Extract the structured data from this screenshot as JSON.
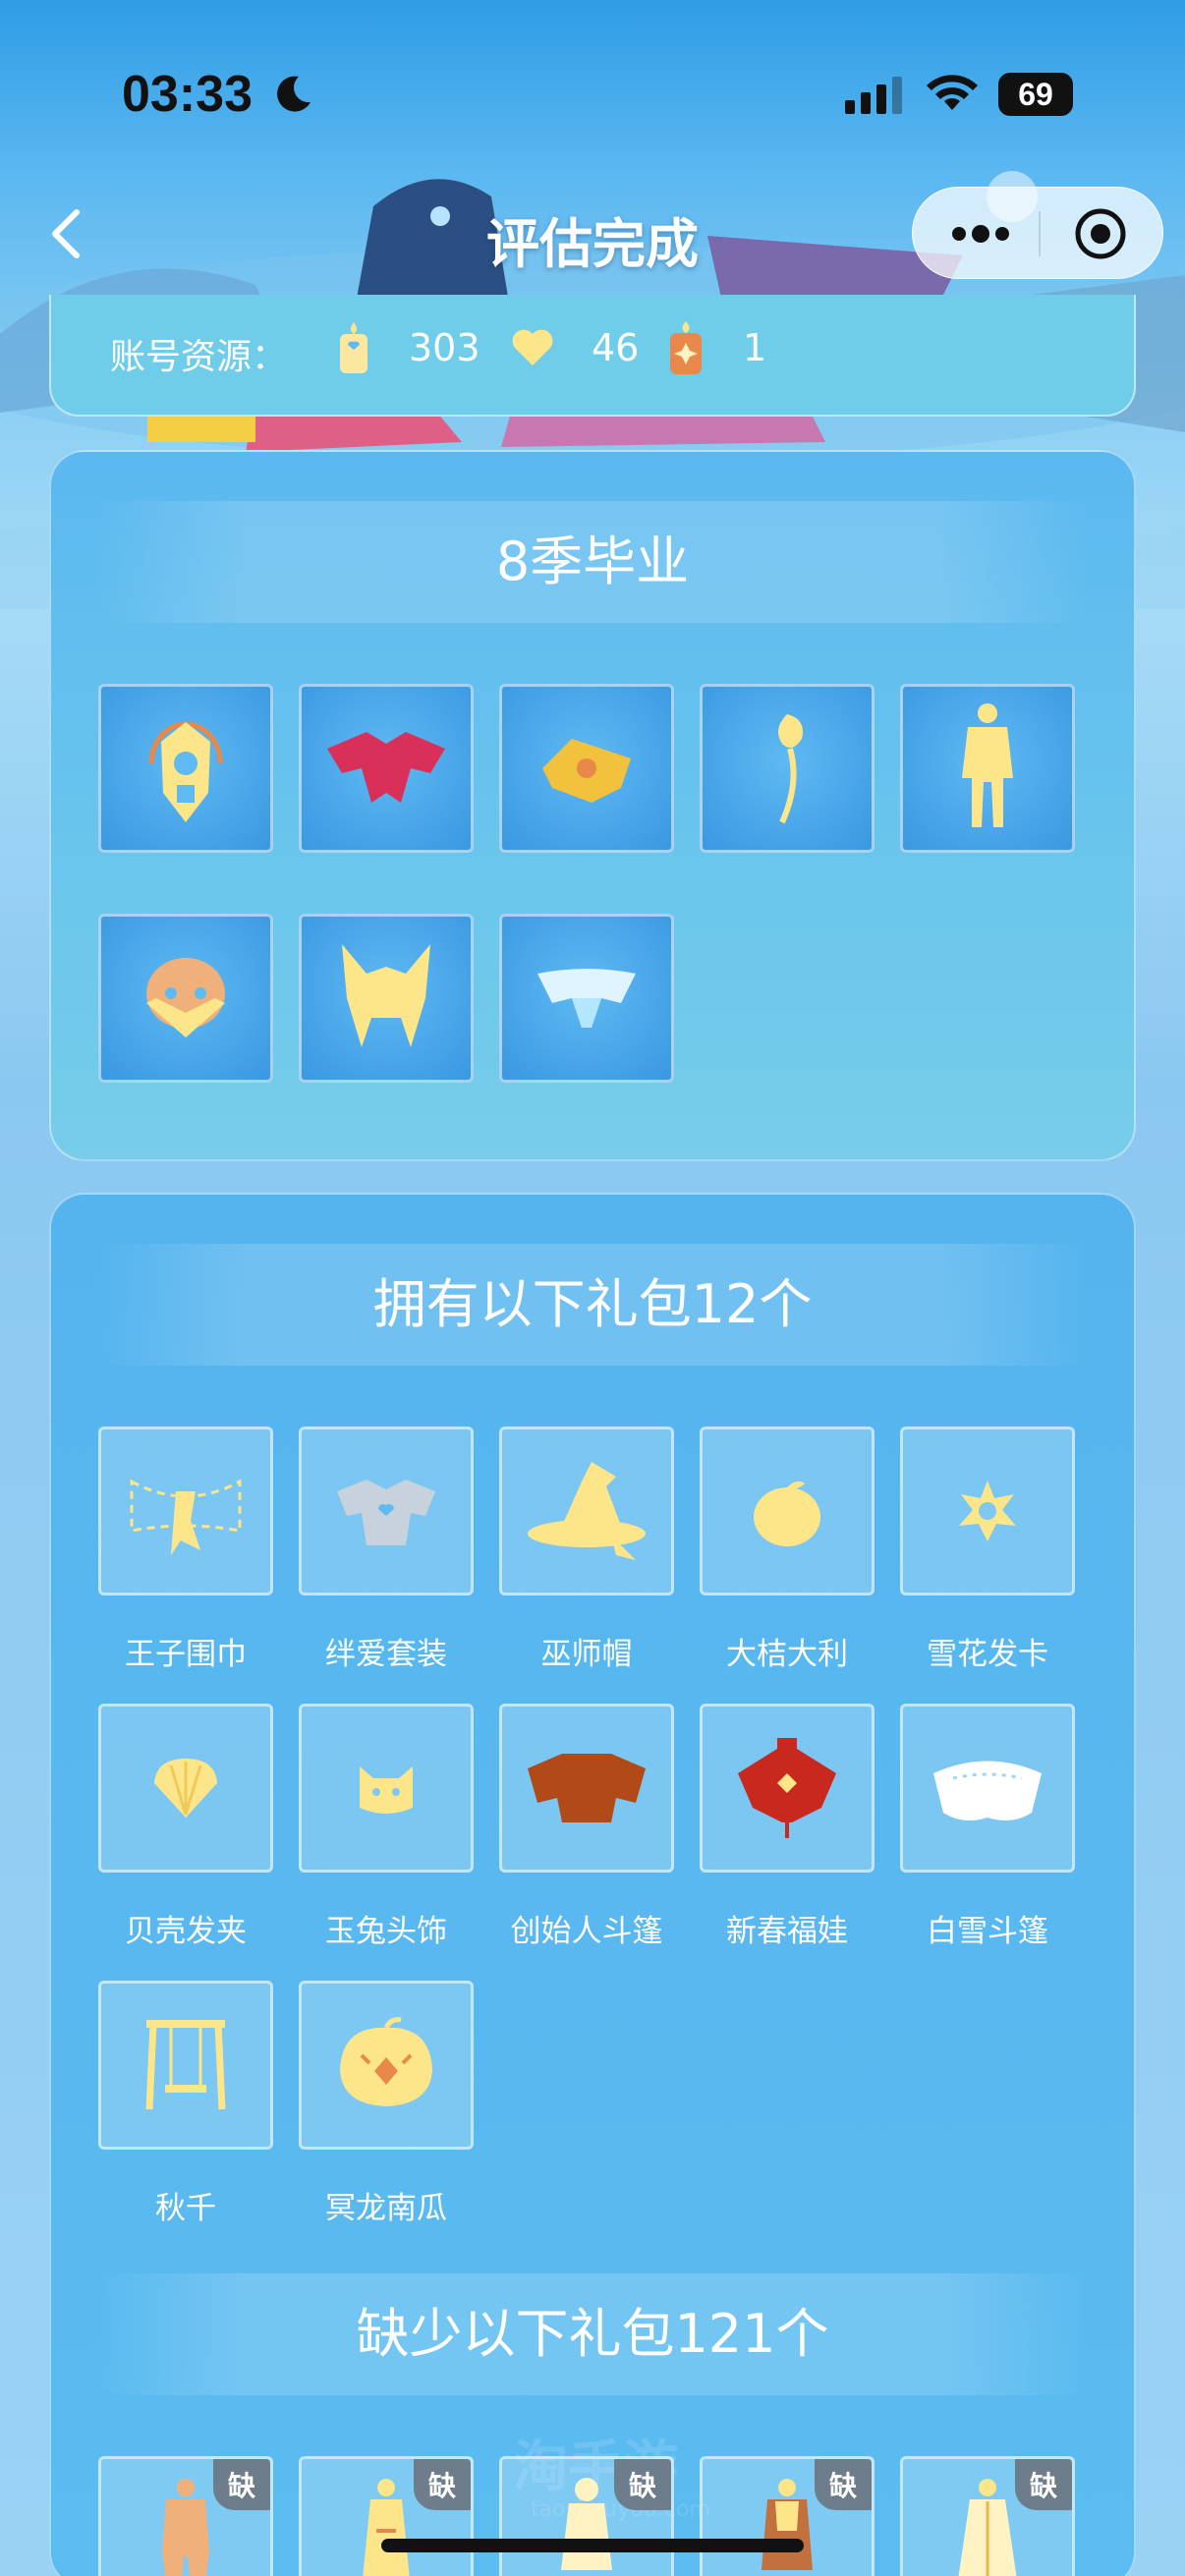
{
  "status": {
    "time": "03:33",
    "battery": "69"
  },
  "nav": {
    "title": "评估完成"
  },
  "resources": {
    "label": "账号资源：",
    "items": [
      {
        "icon": "candle-icon",
        "value": "303"
      },
      {
        "icon": "heart-icon",
        "value": "46"
      },
      {
        "icon": "ascended-candle-icon",
        "value": "1"
      }
    ]
  },
  "season": {
    "title": "8季毕业",
    "items": [
      "lantern-mask-icon",
      "red-cape-icon",
      "gold-scarf-icon",
      "rose-icon",
      "armor-outfit-icon",
      "mask-icon",
      "horned-hair-icon",
      "butterfly-cape-icon"
    ]
  },
  "owned": {
    "title": "拥有以下礼包12个",
    "items": [
      {
        "icon": "scarf-icon",
        "label": "王子围巾"
      },
      {
        "icon": "bond-outfit-icon",
        "label": "绊爱套装"
      },
      {
        "icon": "witch-hat-icon",
        "label": "巫师帽"
      },
      {
        "icon": "orange-icon",
        "label": "大桔大利"
      },
      {
        "icon": "snowflake-icon",
        "label": "雪花发卡"
      },
      {
        "icon": "shell-icon",
        "label": "贝壳发夹"
      },
      {
        "icon": "rabbit-icon",
        "label": "玉兔头饰"
      },
      {
        "icon": "founder-cape-icon",
        "label": "创始人斗篷"
      },
      {
        "icon": "new-year-cape-icon",
        "label": "新春福娃"
      },
      {
        "icon": "white-cape-icon",
        "label": "白雪斗篷"
      },
      {
        "icon": "swing-icon",
        "label": "秋千"
      },
      {
        "icon": "pumpkin-icon",
        "label": "冥龙南瓜"
      }
    ]
  },
  "missing": {
    "title": "缺少以下礼包121个",
    "badge": "缺",
    "items": [
      "outfit-icon-1",
      "outfit-icon-2",
      "outfit-icon-3",
      "outfit-icon-4",
      "outfit-icon-5"
    ]
  },
  "watermark": {
    "main": "淘手游",
    "sub": "taoshouyou.com"
  }
}
